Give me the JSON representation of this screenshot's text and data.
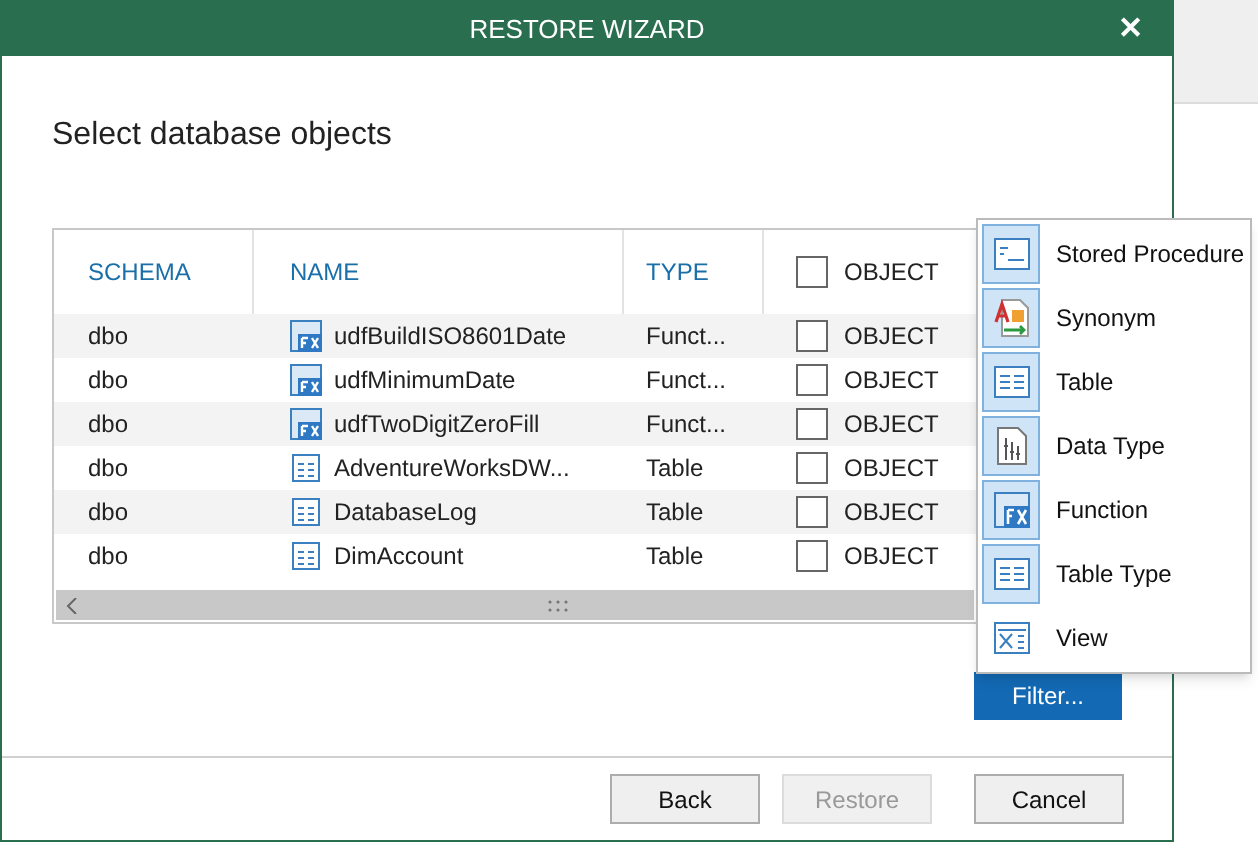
{
  "window": {
    "title": "RESTORE WIZARD",
    "close": "✕"
  },
  "heading": "Select database objects",
  "table": {
    "columns": [
      "SCHEMA",
      "NAME",
      "TYPE",
      "OBJECT"
    ],
    "header_checked": false,
    "rows": [
      {
        "schema": "dbo",
        "name": "udfBuildISO8601Date",
        "kind": "function",
        "type": "Funct...",
        "checked": false,
        "object": "OBJECT"
      },
      {
        "schema": "dbo",
        "name": "udfMinimumDate",
        "kind": "function",
        "type": "Funct...",
        "checked": false,
        "object": "OBJECT"
      },
      {
        "schema": "dbo",
        "name": "udfTwoDigitZeroFill",
        "kind": "function",
        "type": "Funct...",
        "checked": false,
        "object": "OBJECT"
      },
      {
        "schema": "dbo",
        "name": "AdventureWorksDW...",
        "kind": "table",
        "type": "Table",
        "checked": false,
        "object": "OBJECT"
      },
      {
        "schema": "dbo",
        "name": "DatabaseLog",
        "kind": "table",
        "type": "Table",
        "checked": false,
        "object": "OBJECT"
      },
      {
        "schema": "dbo",
        "name": "DimAccount",
        "kind": "table",
        "type": "Table",
        "checked": false,
        "object": "OBJECT"
      }
    ]
  },
  "filter_menu": {
    "items": [
      {
        "label": "Stored Procedure",
        "kind": "procedure",
        "checked": true
      },
      {
        "label": "Synonym",
        "kind": "synonym",
        "checked": true
      },
      {
        "label": "Table",
        "kind": "table",
        "checked": true
      },
      {
        "label": "Data Type",
        "kind": "datatype",
        "checked": true
      },
      {
        "label": "Function",
        "kind": "function",
        "checked": true
      },
      {
        "label": "Table Type",
        "kind": "table",
        "checked": true
      },
      {
        "label": "View",
        "kind": "view",
        "checked": false
      }
    ],
    "button": "Filter..."
  },
  "buttons": [
    {
      "label": "Back",
      "disabled": false
    },
    {
      "label": "Restore",
      "disabled": true
    },
    {
      "label": "Cancel",
      "disabled": false
    }
  ]
}
